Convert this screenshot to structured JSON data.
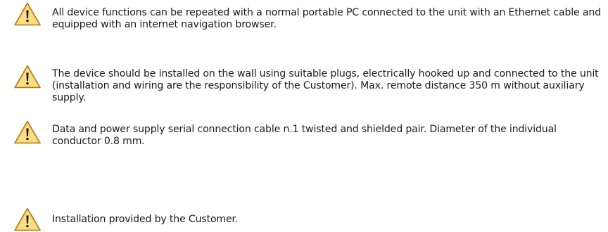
{
  "notes": [
    {
      "icon": "warning-triangle-icon",
      "text": "All device functions can be repeated with a normal portable PC connected to the unit with an Ethernet cable and equipped with an internet navigation browser."
    },
    {
      "icon": "warning-triangle-icon",
      "text": "The device should be installed on the wall using suitable plugs, electrically hooked up and connected to the unit (installation and wiring are the responsibility of the Customer). Max. remote distance 350 m without auxiliary supply."
    },
    {
      "icon": "warning-triangle-icon",
      "text": "Data and power supply serial connection cable n.1 twisted and shielded pair. Diameter of the individual conductor 0.8 mm."
    },
    {
      "icon": "warning-triangle-icon",
      "text": "Installation provided by the Customer."
    }
  ],
  "colors": {
    "icon_fill": "#f6d26a",
    "icon_border": "#b07a1c",
    "icon_mark": "#1a1a1a",
    "text": "#1a1a1a"
  }
}
